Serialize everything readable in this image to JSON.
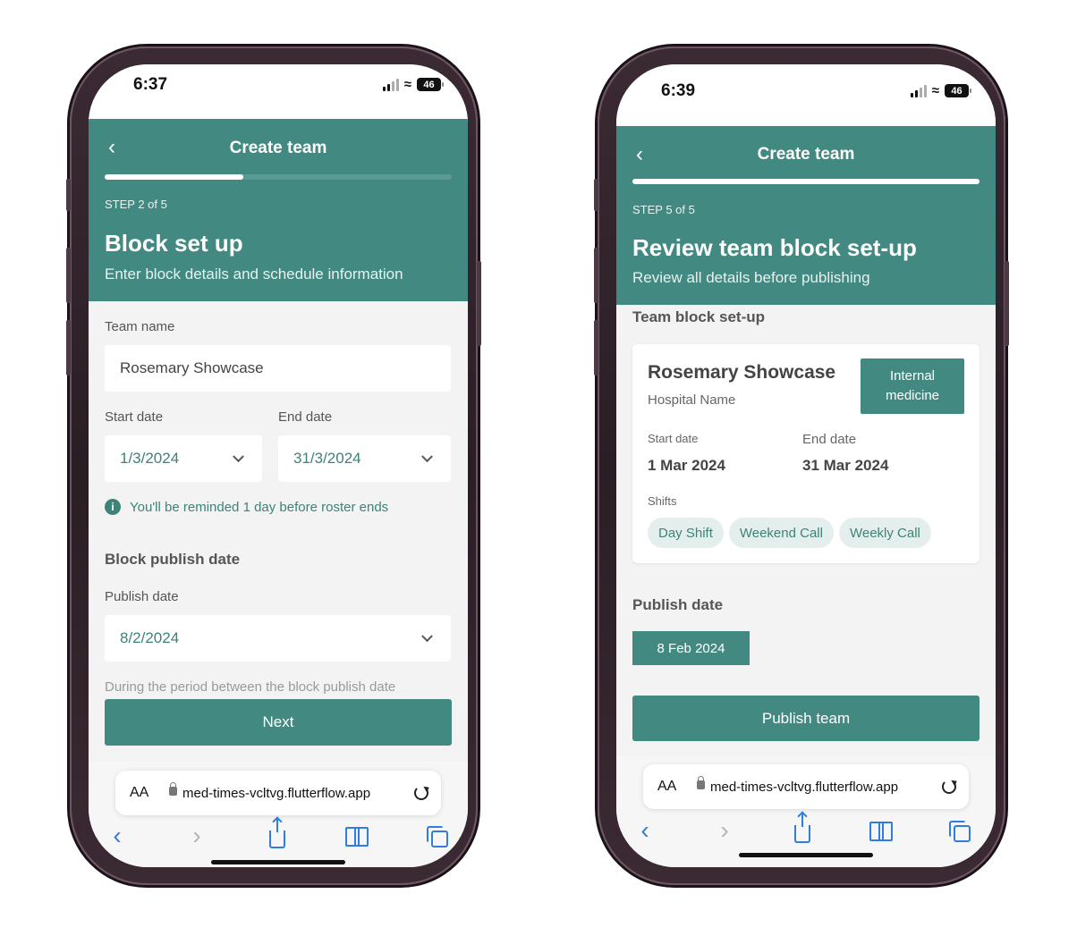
{
  "left": {
    "status": {
      "time": "6:37",
      "battery": "46"
    },
    "header": {
      "back_icon": "chevron-left",
      "title": "Create team",
      "progress": 0.4,
      "step": "STEP 2 of 5",
      "page_title": "Block set up",
      "page_subtitle": "Enter block details and schedule information"
    },
    "form": {
      "team_name_label": "Team name",
      "team_name_value": "Rosemary Showcase",
      "start_date_label": "Start date",
      "start_date_value": "1/3/2024",
      "end_date_label": "End date",
      "end_date_value": "31/3/2024",
      "reminder_icon": "info-icon",
      "reminder_text": "You'll be reminded 1 day before roster ends",
      "publish_section_title": "Block publish date",
      "publish_date_label": "Publish date",
      "publish_date_value": "8/2/2024",
      "publish_note": "During the period between the block publish date"
    },
    "next_button": "Next",
    "browser": {
      "aa": "AA",
      "url": "med-times-vcltvg.flutterflow.app"
    }
  },
  "right": {
    "status": {
      "time": "6:39",
      "battery": "46"
    },
    "header": {
      "back_icon": "chevron-left",
      "title": "Create team",
      "progress": 1.0,
      "step": "STEP 5 of 5",
      "page_title": "Review team block set-up",
      "page_subtitle": "Review all details before publishing"
    },
    "review": {
      "section_title": "Team block set-up",
      "team_name": "Rosemary Showcase",
      "hospital": "Hospital Name",
      "specialty_line1": "Internal",
      "specialty_line2": "medicine",
      "start_label": "Start date",
      "start_value": "1 Mar 2024",
      "end_label": "End date",
      "end_value": "31 Mar 2024",
      "shifts_label": "Shifts",
      "shifts": [
        "Day Shift",
        "Weekend Call",
        "Weekly Call"
      ],
      "publish_title": "Publish date",
      "publish_value": "8 Feb 2024"
    },
    "publish_button": "Publish team",
    "browser": {
      "aa": "AA",
      "url": "med-times-vcltvg.flutterflow.app"
    }
  },
  "colors": {
    "accent": "#428a81",
    "accent_text": "#3d8378",
    "chip_bg": "#e4efed",
    "safari_blue": "#2f7de1"
  }
}
